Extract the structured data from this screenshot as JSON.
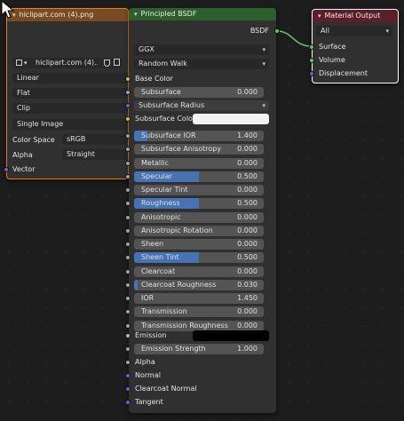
{
  "image_node": {
    "title": "hiclipart.com (4).png",
    "image_name": "hiclipart.com (4)....",
    "interpolation": "Linear",
    "projection": "Flat",
    "extension": "Clip",
    "source": "Single Image",
    "color_space_label": "Color Space",
    "color_space_value": "sRGB",
    "alpha_label": "Alpha",
    "alpha_value": "Straight",
    "vector_label": "Vector"
  },
  "bsdf_node": {
    "title": "Principled BSDF",
    "output_label": "BSDF",
    "distribution": "GGX",
    "subsurface_method": "Random Walk",
    "base_color_label": "Base Color",
    "subsurface": {
      "label": "Subsurface",
      "value": "0.000"
    },
    "subsurface_radius": "Subsurface Radius",
    "subsurface_color_label": "Subsurface Color",
    "params": [
      {
        "label": "Subsurface IOR",
        "value": "1.400",
        "fill": 0.1,
        "sock": "grey"
      },
      {
        "label": "Subsurface Anisotropy",
        "value": "0.000",
        "fill": 0,
        "sock": "grey"
      },
      {
        "label": "Metallic",
        "value": "0.000",
        "fill": 0,
        "sock": "grey"
      },
      {
        "label": "Specular",
        "value": "0.500",
        "fill": 0.5,
        "sock": "grey"
      },
      {
        "label": "Specular Tint",
        "value": "0.000",
        "fill": 0,
        "sock": "grey"
      },
      {
        "label": "Roughness",
        "value": "0.500",
        "fill": 0.5,
        "sock": "grey"
      },
      {
        "label": "Anisotropic",
        "value": "0.000",
        "fill": 0,
        "sock": "grey"
      },
      {
        "label": "Anisotropic Rotation",
        "value": "0.000",
        "fill": 0,
        "sock": "grey"
      },
      {
        "label": "Sheen",
        "value": "0.000",
        "fill": 0,
        "sock": "grey"
      },
      {
        "label": "Sheen Tint",
        "value": "0.500",
        "fill": 0.5,
        "sock": "grey"
      },
      {
        "label": "Clearcoat",
        "value": "0.000",
        "fill": 0,
        "sock": "grey"
      },
      {
        "label": "Clearcoat Roughness",
        "value": "0.030",
        "fill": 0.03,
        "sock": "grey"
      },
      {
        "label": "IOR",
        "value": "1.450",
        "fill": 0,
        "sock": "grey"
      },
      {
        "label": "Transmission",
        "value": "0.000",
        "fill": 0,
        "sock": "grey"
      },
      {
        "label": "Transmission Roughness",
        "value": "0.000",
        "fill": 0,
        "sock": "grey"
      }
    ],
    "emission_label": "Emission",
    "emission_strength": {
      "label": "Emission Strength",
      "value": "1.000"
    },
    "bottom_inputs": [
      "Alpha",
      "Normal",
      "Clearcoat Normal",
      "Tangent"
    ]
  },
  "output_node": {
    "title": "Material Output",
    "target": "All",
    "inputs": [
      "Surface",
      "Volume",
      "Displacement"
    ]
  },
  "colors": {
    "image_header": "#7a4b23",
    "bsdf_header": "#2c5f2c",
    "output_header": "#5e1d2a",
    "active_outline": "#ec7a1f",
    "field_fill": "#4772b3",
    "subsurface_color": "#f2f2f2",
    "emission_color": "#000000"
  }
}
